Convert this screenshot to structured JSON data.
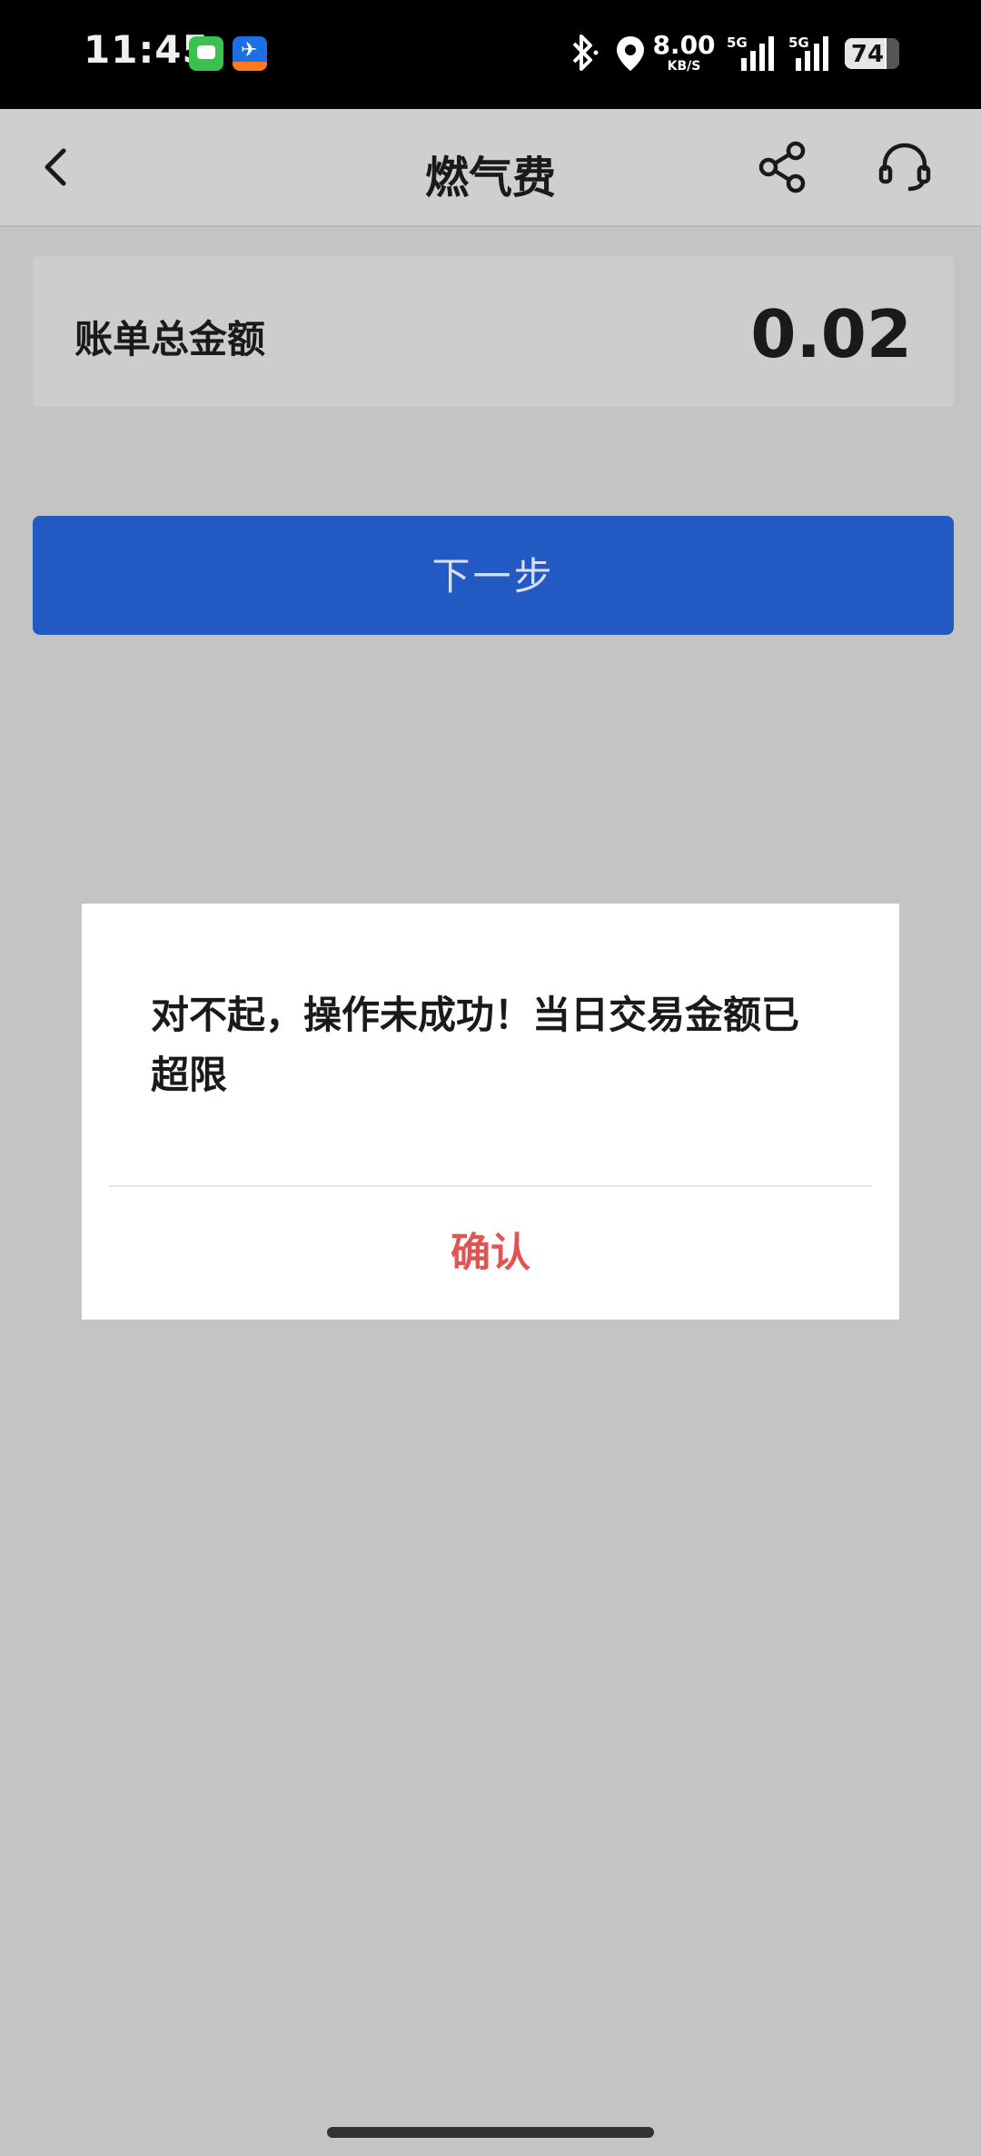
{
  "status_bar": {
    "time": "11:45",
    "net_speed_value": "8.00",
    "net_speed_unit": "KB/S",
    "signal_label_1": "5G",
    "signal_label_2": "5G",
    "battery_percent": "74",
    "battery_level": 0.74,
    "icons": [
      "messages-app-icon",
      "travel-app-icon",
      "bluetooth-icon",
      "location-icon",
      "signal-icon",
      "battery-icon"
    ]
  },
  "nav": {
    "title": "燃气费",
    "icons": [
      "back-icon",
      "share-icon",
      "customer-service-icon"
    ]
  },
  "bill": {
    "label": "账单总金额",
    "amount": "0.02"
  },
  "next_button_label": "下一步",
  "dialog": {
    "message": "对不起，操作未成功！当日交易金额已超限",
    "confirm_label": "确认",
    "confirm_color": "#e05454"
  },
  "colors": {
    "primary_button": "#2359c2",
    "overlay_background": "#c4c4c4"
  }
}
